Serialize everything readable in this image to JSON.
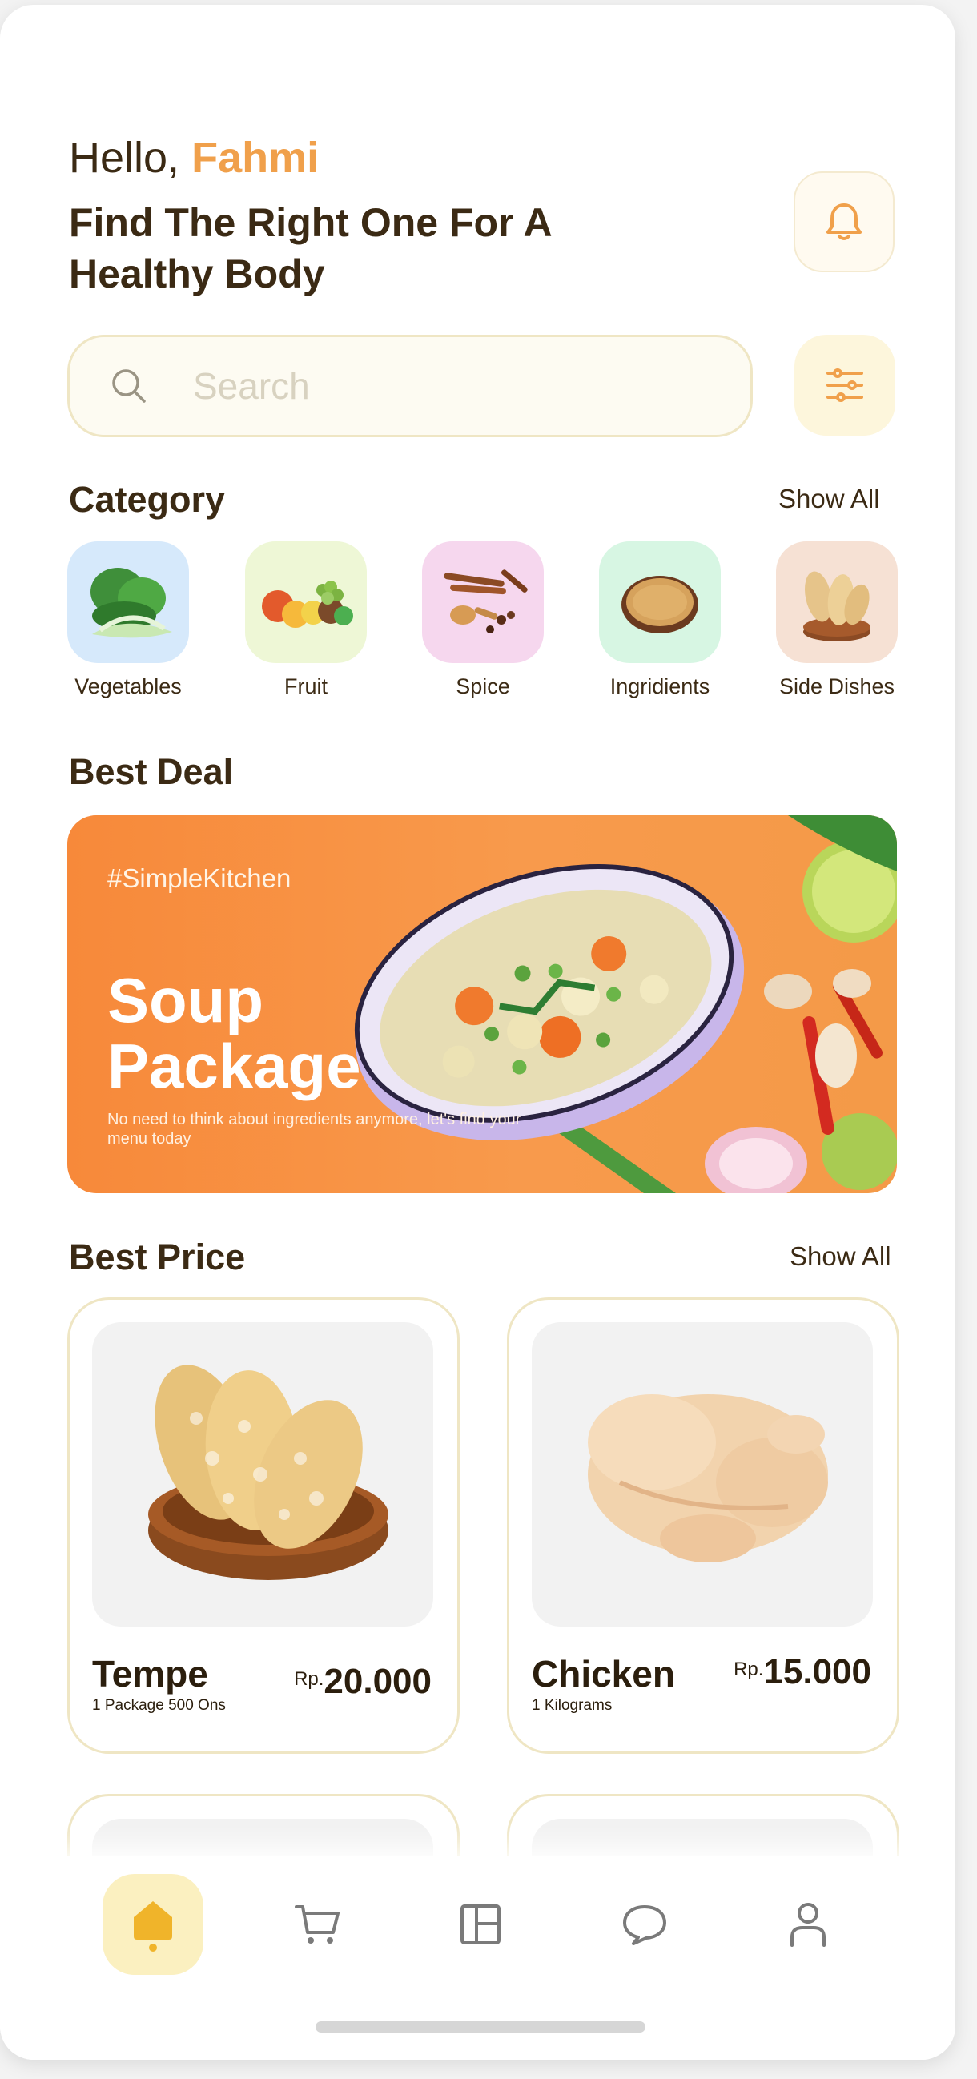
{
  "header": {
    "greeting": "Hello,",
    "user_name": "Fahmi",
    "headline": "Find The Right One For A Healthy Body"
  },
  "search": {
    "placeholder": "Search"
  },
  "category": {
    "title": "Category",
    "show_all": "Show All",
    "items": [
      {
        "label": "Vegetables",
        "icon": "vegetables-icon",
        "bg": "#d6e9fb"
      },
      {
        "label": "Fruit",
        "icon": "fruit-icon",
        "bg": "#eef7d6"
      },
      {
        "label": "Spice",
        "icon": "spice-icon",
        "bg": "#f6d7ee"
      },
      {
        "label": "Ingridients",
        "icon": "ingredients-icon",
        "bg": "#d7f6e3"
      },
      {
        "label": "Side Dishes",
        "icon": "side-dishes-icon",
        "bg": "#f6e1d4"
      }
    ]
  },
  "best_deal": {
    "title": "Best Deal",
    "banner": {
      "tag": "#SimpleKitchen",
      "title": "Soup Package",
      "description": "No need to think about ingredients anymore, let's find your menu today"
    }
  },
  "best_price": {
    "title": "Best Price",
    "show_all": "Show All",
    "products": [
      {
        "name": "Tempe",
        "unit": "1 Package 500 Ons",
        "currency": "Rp.",
        "price": "20.000"
      },
      {
        "name": "Chicken",
        "unit": "1 Kilograms",
        "currency": "Rp.",
        "price": "15.000"
      }
    ]
  },
  "nav": {
    "items": [
      "home-icon",
      "cart-icon",
      "layout-icon",
      "chat-icon",
      "profile-icon"
    ],
    "active": "home-icon"
  },
  "colors": {
    "accent": "#f0a04b",
    "text": "#3b2a14",
    "banner": "#f7893a",
    "nav_active": "#fbf0c0"
  }
}
